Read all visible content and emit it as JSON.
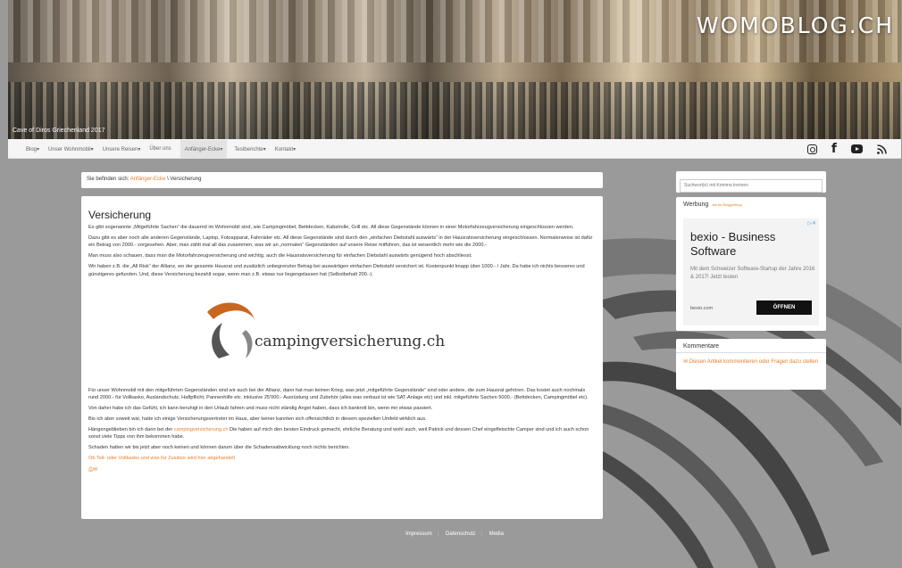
{
  "banner": {
    "caption": "Cave of Diros Griechenland 2017",
    "logo": "WOMOBLOG.CH"
  },
  "nav": {
    "items": [
      {
        "label": "Blog",
        "caret": true
      },
      {
        "label": "Unser Wohnmobil",
        "caret": true
      },
      {
        "label": "Unsere Reisen",
        "caret": true
      },
      {
        "label": "Über uns",
        "caret": false
      },
      {
        "label": "Anfänger-Ecke",
        "caret": true,
        "active": true
      },
      {
        "label": "Testberichte",
        "caret": true
      },
      {
        "label": "Kontakt",
        "caret": true
      }
    ],
    "social": [
      "instagram-icon",
      "facebook-icon",
      "youtube-icon",
      "rss-icon"
    ]
  },
  "breadcrumb": {
    "prefix": "Sie befinden sich: ",
    "link": "Anfänger-Ecke",
    "separator": " \\ ",
    "current": "Versicherung"
  },
  "article": {
    "title": "Versicherung",
    "paragraphs_top": [
      "Es gibt sogenannte „Mitgeführte Sachen“ die dauernd im Wohnmobil sind, wie Campingmöbel, Bettdecken, Kabelrolle, Grill etc. All diese Gegenstände können in einer Motorfahrzeugversicherung eingeschlossen werden.",
      "Dazu gibt es aber noch alle anderen Gegenstände, Laptop, Fotoapparat, Fahrräder etc. All diese Gegenstände sind durch den „einfachen Diebstahl auswärts“ in der Hausratsversicherung eingeschlossen. Normalerweise ist dafür ein Betrag von 2000.- vorgesehen. Aber, man zählt mal all das zusammen, was wir an „normalen“ Gegenständen auf unsere Reise mitführen, das ist wesentlich mehr wie die 2000.-",
      "Man muss also schauen, dass man die Motorfahrzeugversicherung und wichtig, auch die Hausratsversicherung für einfachen Diebstahl auswärts genügend hoch abschliesst.",
      "Wir haben z.B. die „All Risk“ der Allianz, wo der gesamte Hausrat und zusätzlich unbegrenzter Betrag bei auswärtigen einfachen Diebstahl versichert ist. Kostenpunkt knapp über 1000.- / Jahr. Da habe ich nichts besseres und günstigeres gefunden. Und, diese Versicherung bezahlt sogar, wenn man z.B. etwas nur liegengelassen hat (Selbstbehalt 200.-)."
    ],
    "image_text": "campingversicherung.ch",
    "paragraphs_bottom": [
      "Für unser Wohnmobil mit den mitgeführten Gegenständen sind wir auch bei der Allianz, dann hat man keinen Krieg, was jetzt „mitgeführte Gegenstände“ sind oder andere, die zum Hausrat gehören. Das kostet auch nochmals rund 2000.- für Vollkasko, Auslandschutz, Haftpflicht, Pannenhilfe etc. inklusive 25'000.- Ausrüstung und Zubehör (alles was verbaut ist wie SAT-Anlage etc) und inkl. mitgeführte Sachen 5000.- (Bettdecken, Campingmöbel etc).",
      "Von daher habe ich das Gefühl, ich kann beruhigt in den Urlaub fahren und muss nicht ständig Angst haben, dass ich bankrott bin, wenn mir etwas passiert.",
      "Bis ich aber soweit war, hatte ich einige Versicherungsvertreter im Haus, aber keiner kannten sich offensichtlich in diesem speziellen Umfeld wirklich aus."
    ],
    "p_camping_prefix": "Hängengeblieben bin ich dann bei der ",
    "p_camping_link": "campingversicherung.ch",
    "p_camping_suffix": " Die haben auf mich den besten Eindruck gemacht, ehrliche Beratung und wohl auch, weil Patrick und dessen Chef eingefleischte Camper sind und ich auch schon sonst viele Tipps von ihm bekommen habe.",
    "p_last": "Schaden hatten wir bis jetzt aber noch keinen und können darum über die Schadensabwicklung noch nichts berichten.",
    "link_more": "Ob Teil- oder Vollkasko und was für Zusätze wird hier abgehandelt"
  },
  "sidebar": {
    "search_placeholder": "Suchwort(e) mit Komma trennen",
    "ad": {
      "heading": "Werbung",
      "subheading": "werbe Bloggerblog",
      "title": "bexio - Business Software",
      "text": "Mit dem Schweizer Software-Startup der Jahre 2016 & 2017! Jetzt testen",
      "domain": "bexio.com",
      "button": "ÖFFNEN"
    },
    "comments": {
      "heading": "Kommentare",
      "link": "Diesen Artikel kommentieren oder Fragen dazu stellen"
    }
  },
  "footer": {
    "links": [
      "Impressum",
      "Datenschutz",
      "Media"
    ]
  },
  "colors": {
    "accent": "#e87f2c",
    "background": "#9a9a9a"
  }
}
